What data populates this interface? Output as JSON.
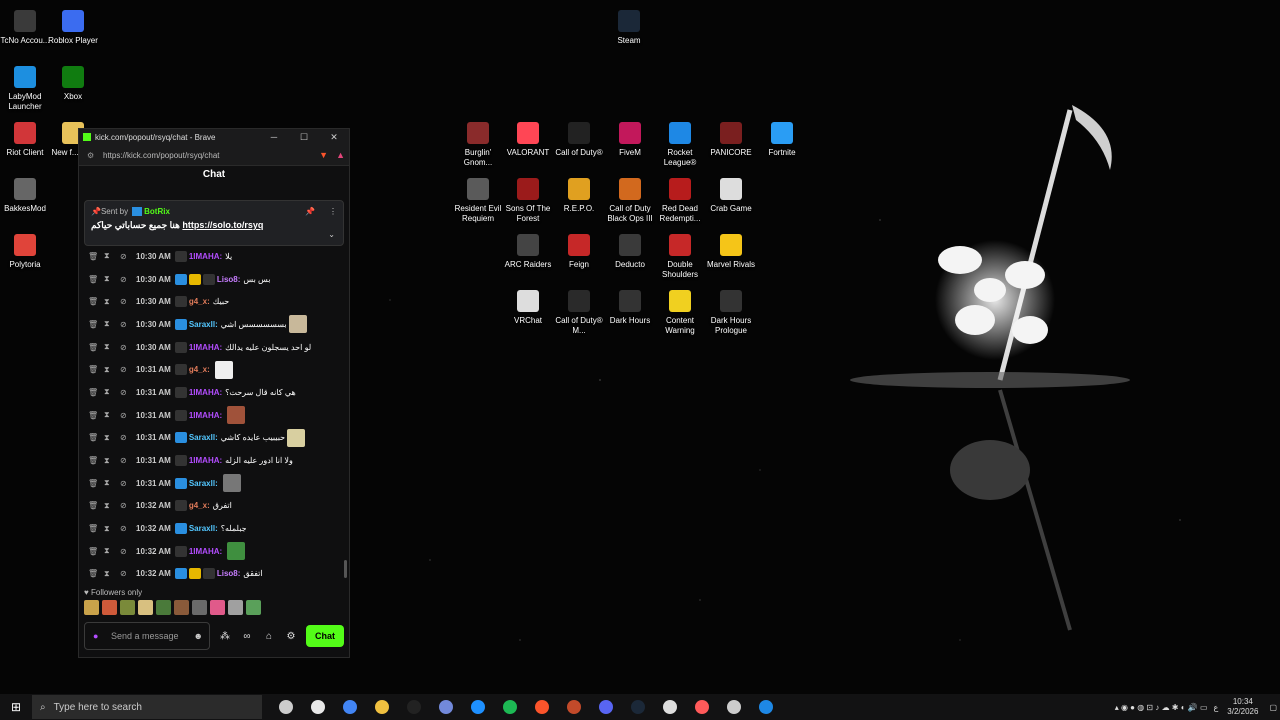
{
  "desktop_icons": [
    {
      "label": "TcNo Accou...",
      "color": "#3a3a3a"
    },
    {
      "label": "Roblox Player",
      "color": "#3b6cf0"
    },
    {
      "label": "LabyMod Launcher",
      "color": "#1d8fe0"
    },
    {
      "label": "Xbox",
      "color": "#107c10"
    },
    {
      "label": "Riot Client",
      "color": "#d13639"
    },
    {
      "label": "New f... (2...",
      "color": "#e8c25a"
    },
    {
      "label": "BakkesMod",
      "color": "#666666"
    },
    {
      "label": "Polytoria",
      "color": "#e0443a"
    },
    {
      "label": "Steam",
      "color": "#1b2838"
    },
    {
      "label": "Burglin' Gnom...",
      "color": "#8a2b2b"
    },
    {
      "label": "VALORANT",
      "color": "#ff4655"
    },
    {
      "label": "Call of Duty®",
      "color": "#222222"
    },
    {
      "label": "FiveM",
      "color": "#c2185b"
    },
    {
      "label": "Rocket League®",
      "color": "#1e88e5"
    },
    {
      "label": "PANICORE",
      "color": "#7a1f1f"
    },
    {
      "label": "Fortnite",
      "color": "#2a9df4"
    },
    {
      "label": "Resident Evil Requiem",
      "color": "#5a5a5a"
    },
    {
      "label": "Sons Of The Forest",
      "color": "#9b1b1b"
    },
    {
      "label": "R.E.P.O.",
      "color": "#e0a020"
    },
    {
      "label": "Call of Duty Black Ops III",
      "color": "#d2691e"
    },
    {
      "label": "Red Dead Redempti...",
      "color": "#b71c1c"
    },
    {
      "label": "Crab Game",
      "color": "#dddddd"
    },
    {
      "label": "ARC Raiders",
      "color": "#444444"
    },
    {
      "label": "Feign",
      "color": "#c62828"
    },
    {
      "label": "Deducto",
      "color": "#3a3a3a"
    },
    {
      "label": "Double Shoulders",
      "color": "#c62828"
    },
    {
      "label": "Marvel Rivals",
      "color": "#f5c518"
    },
    {
      "label": "VRChat",
      "color": "#dddddd"
    },
    {
      "label": "Call of Duty® M...",
      "color": "#2a2a2a"
    },
    {
      "label": "Dark Hours",
      "color": "#333333"
    },
    {
      "label": "Content Warning",
      "color": "#f0d020"
    },
    {
      "label": "Dark Hours Prologue",
      "color": "#333333"
    }
  ],
  "window": {
    "title": "kick.com/popout/rsyq/chat - Brave",
    "minimize": "─",
    "maximize": "☐",
    "close": "✕",
    "url": "https://kick.com/popout/rsyq/chat"
  },
  "chat": {
    "header": "Chat",
    "pinned": {
      "sent_by": "Sent by",
      "bot": "BotRix",
      "text": "هنا جميع حساباتي حياكم",
      "link": "https://solo.to/rsyq"
    },
    "messages": [
      {
        "time": "10:30 AM",
        "badges": [
          "dark"
        ],
        "user": "1IMAHA:",
        "color": "#b34dff",
        "text": "يلا",
        "emote": null
      },
      {
        "time": "10:30 AM",
        "badges": [
          "kick",
          "crown",
          "dark"
        ],
        "user": "Liso8:",
        "color": "#c77dff",
        "text": "بس بس",
        "emote": null
      },
      {
        "time": "10:30 AM",
        "badges": [
          "dark"
        ],
        "user": "g4_x:",
        "color": "#e07b5a",
        "text": "حبيك",
        "emote": null
      },
      {
        "time": "10:30 AM",
        "badges": [
          "kick"
        ],
        "user": "Saraxll:",
        "color": "#53c7ff",
        "text": "بسسسسسس اشي",
        "emote": "#c8b89a"
      },
      {
        "time": "10:30 AM",
        "badges": [
          "dark"
        ],
        "user": "1IMAHA:",
        "color": "#b34dff",
        "text": "لو احد يسجلون عليه يدالك",
        "emote": null
      },
      {
        "time": "10:31 AM",
        "badges": [
          "dark"
        ],
        "user": "g4_x:",
        "color": "#e07b5a",
        "text": "",
        "emote": "#eeeeee"
      },
      {
        "time": "10:31 AM",
        "badges": [
          "dark"
        ],
        "user": "1IMAHA:",
        "color": "#b34dff",
        "text": "هي كانه قال سرحت؟",
        "emote": null
      },
      {
        "time": "10:31 AM",
        "badges": [
          "dark"
        ],
        "user": "1IMAHA:",
        "color": "#b34dff",
        "text": "",
        "emote": "#a0523a"
      },
      {
        "time": "10:31 AM",
        "badges": [
          "kick"
        ],
        "user": "Saraxll:",
        "color": "#53c7ff",
        "text": "حبيبيب عايده كاشي",
        "emote": "#d8cfa0"
      },
      {
        "time": "10:31 AM",
        "badges": [
          "dark"
        ],
        "user": "1IMAHA:",
        "color": "#b34dff",
        "text": "ولا انا ادور عليه الزله",
        "emote": null
      },
      {
        "time": "10:31 AM",
        "badges": [
          "kick"
        ],
        "user": "Saraxll:",
        "color": "#53c7ff",
        "text": "",
        "emote": "#777777"
      },
      {
        "time": "10:32 AM",
        "badges": [
          "dark"
        ],
        "user": "g4_x:",
        "color": "#e07b5a",
        "text": "اتفرق",
        "emote": null
      },
      {
        "time": "10:32 AM",
        "badges": [
          "kick"
        ],
        "user": "Saraxll:",
        "color": "#53c7ff",
        "text": "جبلمله؟",
        "emote": null
      },
      {
        "time": "10:32 AM",
        "badges": [
          "dark"
        ],
        "user": "1IMAHA:",
        "color": "#b34dff",
        "text": "",
        "emote": "#3f8f3f"
      },
      {
        "time": "10:32 AM",
        "badges": [
          "kick",
          "crown",
          "dark"
        ],
        "user": "Liso8:",
        "color": "#c77dff",
        "text": "اتفقق",
        "emote": null
      }
    ],
    "followers_only": "Followers only",
    "emote_bar": [
      "#c9a24a",
      "#d05a3a",
      "#7a8a3a",
      "#d8c080",
      "#4a7a3a",
      "#8a5a3a",
      "#6a6a6a",
      "#e05a8a",
      "#a0a0a0",
      "#5aa05a"
    ],
    "input_placeholder": "Send a message",
    "send_label": "Chat"
  },
  "taskbar": {
    "search_placeholder": "Type here to search",
    "apps": [
      "#cccccc",
      "#e8e8e8",
      "#4285f4",
      "#f0c040",
      "#222222",
      "#7289da",
      "#1e90ff",
      "#1db954",
      "#fb542b",
      "#c24a2a",
      "#5865f2",
      "#1b2838",
      "#dddddd",
      "#ff5a5a",
      "#cccccc",
      "#1e88e5"
    ],
    "lang": "ع",
    "time": "10:34",
    "date": "3/2/2026"
  }
}
